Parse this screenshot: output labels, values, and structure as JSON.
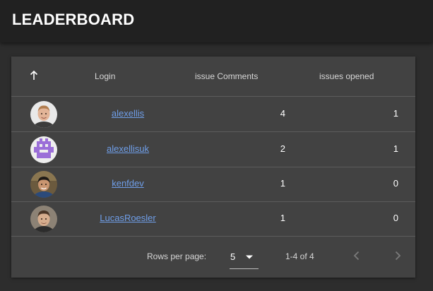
{
  "header": {
    "title": "LEADERBOARD"
  },
  "table": {
    "columns": {
      "sort_icon": "arrow-up-icon",
      "login": "Login",
      "comments": "issue Comments",
      "opened": "issues opened"
    },
    "rows": [
      {
        "login": "alexellis",
        "comments": "4",
        "opened": "1"
      },
      {
        "login": "alexellisuk",
        "comments": "2",
        "opened": "1"
      },
      {
        "login": "kenfdev",
        "comments": "1",
        "opened": "0"
      },
      {
        "login": "LucasRoesler",
        "comments": "1",
        "opened": "0"
      }
    ]
  },
  "pagination": {
    "rows_per_page_label": "Rows per page:",
    "rows_per_page_value": "5",
    "range_text": "1-4 of 4",
    "prev_icon": "chevron-left-icon",
    "next_icon": "chevron-right-icon"
  },
  "colors": {
    "background": "#2d2d2d",
    "appbar": "#212121",
    "card": "#424242",
    "link": "#6f9ee8",
    "divider": "#5c5c5c"
  }
}
